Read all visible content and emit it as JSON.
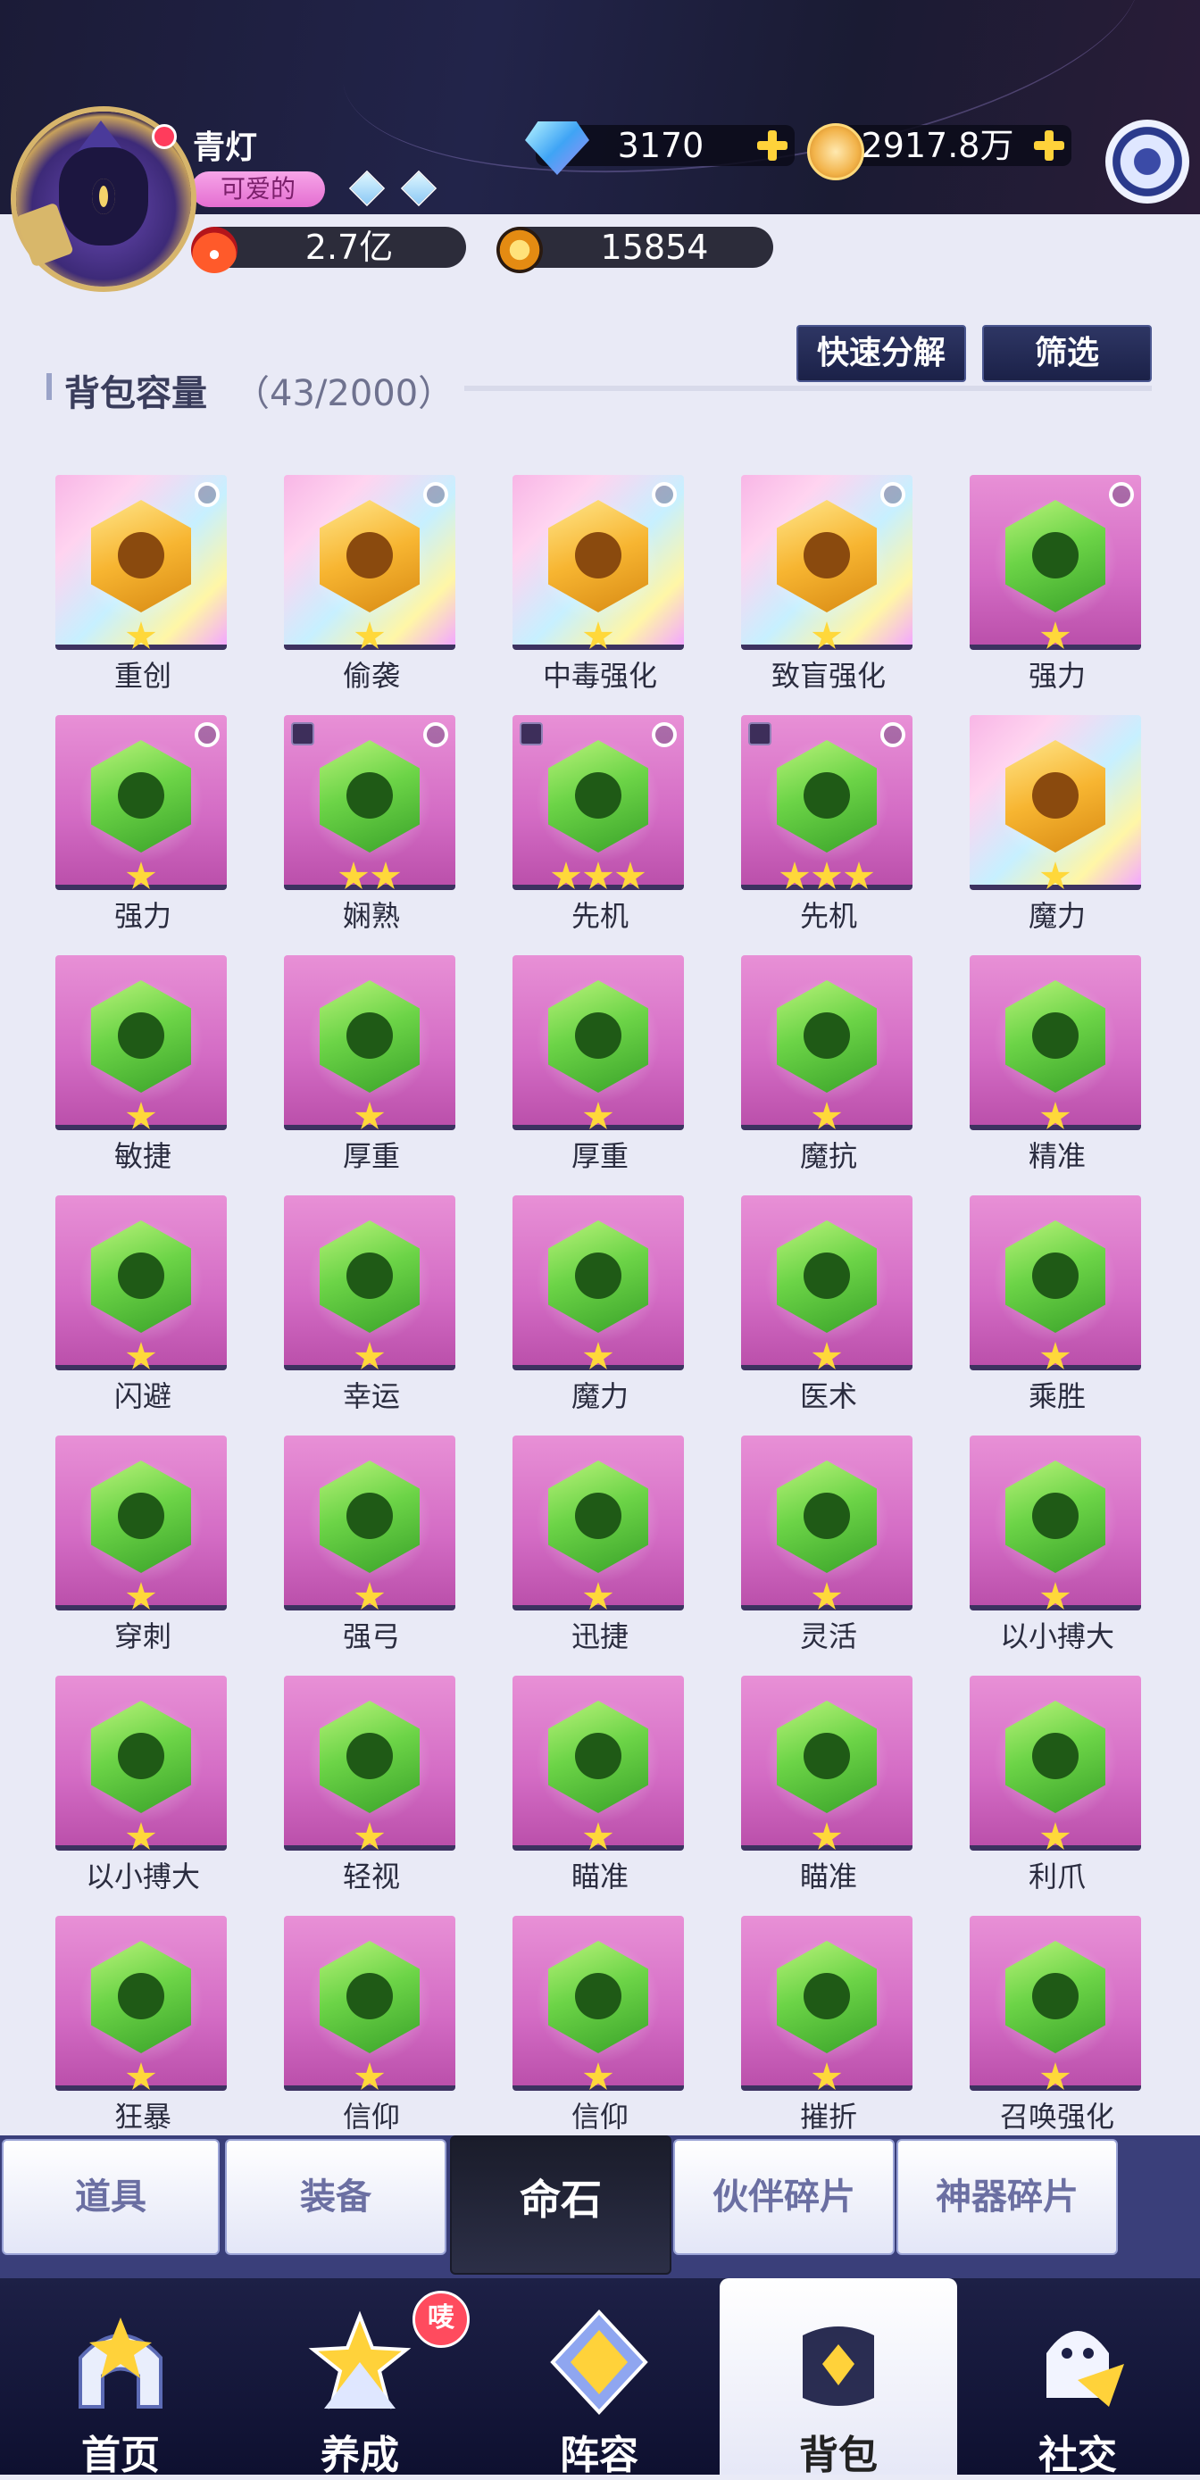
{
  "player": {
    "name": "青灯",
    "title": "可爱的",
    "power": "2.7亿",
    "points": "15854"
  },
  "resources": {
    "gems": "3170",
    "coins": "2917.8万"
  },
  "bag": {
    "title": "背包容量",
    "count": "（43/2000）",
    "quick_decompose": "快速分解",
    "filter": "筛选"
  },
  "items": [
    {
      "label": "重创",
      "stars": 1,
      "gold": true,
      "radio": true,
      "lock": false,
      "icon": "fist-burst-icon"
    },
    {
      "label": "偷袭",
      "stars": 1,
      "gold": true,
      "radio": true,
      "lock": false,
      "icon": "paw-icon"
    },
    {
      "label": "中毒强化",
      "stars": 1,
      "gold": true,
      "radio": true,
      "lock": false,
      "icon": "poison-flask-icon"
    },
    {
      "label": "致盲强化",
      "stars": 1,
      "gold": true,
      "radio": true,
      "lock": false,
      "icon": "blind-eye-icon"
    },
    {
      "label": "强力",
      "stars": 1,
      "gold": false,
      "radio": true,
      "lock": false,
      "icon": "fist-icon"
    },
    {
      "label": "强力",
      "stars": 1,
      "gold": false,
      "radio": true,
      "lock": false,
      "icon": "fist-icon"
    },
    {
      "label": "娴熟",
      "stars": 2,
      "gold": false,
      "radio": true,
      "lock": true,
      "icon": "sword-icon"
    },
    {
      "label": "先机",
      "stars": 3,
      "gold": false,
      "radio": true,
      "lock": true,
      "icon": "bow-icon"
    },
    {
      "label": "先机",
      "stars": 3,
      "gold": false,
      "radio": true,
      "lock": true,
      "icon": "bow-icon"
    },
    {
      "label": "魔力",
      "stars": 1,
      "gold": true,
      "radio": false,
      "lock": false,
      "icon": "potion-icon"
    },
    {
      "label": "敏捷",
      "stars": 1,
      "gold": false,
      "radio": false,
      "lock": false,
      "icon": "lightning-icon"
    },
    {
      "label": "厚重",
      "stars": 1,
      "gold": false,
      "radio": false,
      "lock": false,
      "icon": "shield-icon"
    },
    {
      "label": "厚重",
      "stars": 1,
      "gold": false,
      "radio": false,
      "lock": false,
      "icon": "shield-icon"
    },
    {
      "label": "魔抗",
      "stars": 1,
      "gold": false,
      "radio": false,
      "lock": false,
      "icon": "magic-resist-icon"
    },
    {
      "label": "精准",
      "stars": 1,
      "gold": false,
      "radio": false,
      "lock": false,
      "icon": "crosshair-icon"
    },
    {
      "label": "闪避",
      "stars": 1,
      "gold": false,
      "radio": false,
      "lock": false,
      "icon": "dodge-icon"
    },
    {
      "label": "幸运",
      "stars": 1,
      "gold": false,
      "radio": false,
      "lock": false,
      "icon": "clover-icon"
    },
    {
      "label": "魔力",
      "stars": 1,
      "gold": false,
      "radio": false,
      "lock": false,
      "icon": "potion-icon"
    },
    {
      "label": "医术",
      "stars": 1,
      "gold": false,
      "radio": false,
      "lock": false,
      "icon": "medic-icon"
    },
    {
      "label": "乘胜",
      "stars": 1,
      "gold": false,
      "radio": false,
      "lock": false,
      "icon": "heart-bolt-icon"
    },
    {
      "label": "穿刺",
      "stars": 1,
      "gold": false,
      "radio": false,
      "lock": false,
      "icon": "arrow-pierce-icon"
    },
    {
      "label": "强弓",
      "stars": 1,
      "gold": false,
      "radio": false,
      "lock": false,
      "icon": "arrows-icon"
    },
    {
      "label": "迅捷",
      "stars": 1,
      "gold": false,
      "radio": false,
      "lock": false,
      "icon": "swift-icon"
    },
    {
      "label": "灵活",
      "stars": 1,
      "gold": false,
      "radio": false,
      "lock": false,
      "icon": "agile-icon"
    },
    {
      "label": "以小搏大",
      "stars": 1,
      "gold": false,
      "radio": false,
      "lock": false,
      "icon": "underdog-icon"
    },
    {
      "label": "以小搏大",
      "stars": 1,
      "gold": false,
      "radio": false,
      "lock": false,
      "icon": "underdog-icon"
    },
    {
      "label": "轻视",
      "stars": 1,
      "gold": false,
      "radio": false,
      "lock": false,
      "icon": "disdain-icon"
    },
    {
      "label": "瞄准",
      "stars": 1,
      "gold": false,
      "radio": false,
      "lock": false,
      "icon": "target-icon"
    },
    {
      "label": "瞄准",
      "stars": 1,
      "gold": false,
      "radio": false,
      "lock": false,
      "icon": "target-icon"
    },
    {
      "label": "利爪",
      "stars": 1,
      "gold": false,
      "radio": false,
      "lock": false,
      "icon": "claw-icon"
    },
    {
      "label": "狂暴",
      "stars": 1,
      "gold": false,
      "radio": false,
      "lock": false,
      "icon": "rage-icon"
    },
    {
      "label": "信仰",
      "stars": 1,
      "gold": false,
      "radio": false,
      "lock": false,
      "icon": "halo-icon"
    },
    {
      "label": "信仰",
      "stars": 1,
      "gold": false,
      "radio": false,
      "lock": false,
      "icon": "halo-icon"
    },
    {
      "label": "摧折",
      "stars": 1,
      "gold": false,
      "radio": false,
      "lock": false,
      "icon": "demon-icon"
    },
    {
      "label": "召唤强化",
      "stars": 1,
      "gold": false,
      "radio": false,
      "lock": false,
      "icon": "summon-circle-icon"
    }
  ],
  "tabs": [
    {
      "label": "道具",
      "active": false
    },
    {
      "label": "装备",
      "active": false
    },
    {
      "label": "命石",
      "active": true
    },
    {
      "label": "伙伴碎片",
      "active": false
    },
    {
      "label": "神器碎片",
      "active": false
    }
  ],
  "nav": [
    {
      "label": "首页",
      "active": false,
      "icon": "home-castle-icon"
    },
    {
      "label": "养成",
      "active": false,
      "icon": "star-upgrade-icon",
      "badge": "唛"
    },
    {
      "label": "阵容",
      "active": false,
      "icon": "formation-icon"
    },
    {
      "label": "背包",
      "active": true,
      "icon": "backpack-icon"
    },
    {
      "label": "社交",
      "active": false,
      "icon": "social-ghost-icon"
    }
  ],
  "colors": {
    "tile_pink": "#d36bc4",
    "hex_green": "#6cd447",
    "hex_gold": "#f7b531",
    "star_yellow": "#ffd83a",
    "nav_bg": "#1d2046"
  }
}
